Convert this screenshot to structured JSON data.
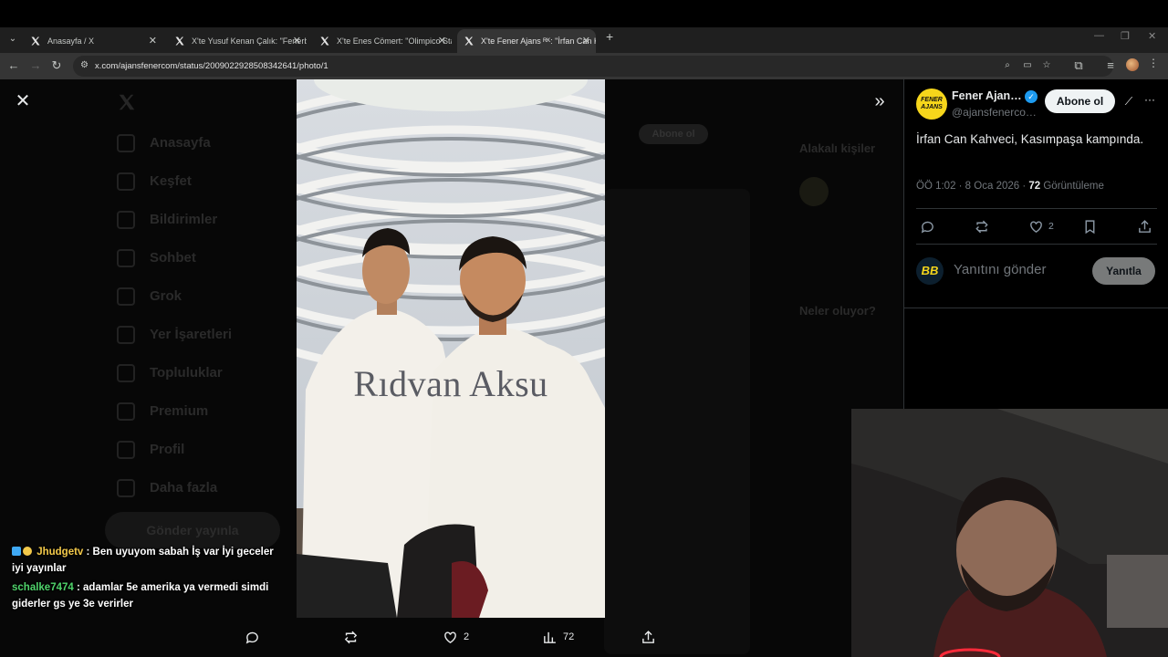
{
  "browser": {
    "tabs": [
      {
        "title": "Anasayfa / X",
        "active": false
      },
      {
        "title": "X'te Yusuf Kenan Çalık: \"Fenerb",
        "active": false
      },
      {
        "title": "X'te Enes Cömert: \"Olimpico Sta",
        "active": false
      },
      {
        "title": "X'te Fener Ajans ᴿᴷ: \"İrfan Can K",
        "active": true
      }
    ],
    "url": "x.com/ajansfenercom/status/2009022928508342641/photo/1"
  },
  "photo": {
    "watermark": "Rıdvan Aksu"
  },
  "photo_actions": {
    "likes": "2",
    "views": "72"
  },
  "chat": [
    {
      "user": "Jhudgetv",
      "text": ": Ben uyuyom sabah İş var İyi geceler iyi yayınlar"
    },
    {
      "user": "schalke7474",
      "text": ": adamlar 5e amerika ya vermedi simdi giderler gs ye 3e verirler"
    }
  ],
  "background_nav": [
    "Anasayfa",
    "Keşfet",
    "Bildirimler",
    "Sohbet",
    "Grok",
    "Yer İşaretleri",
    "Topluluklar",
    "Premium",
    "Profil",
    "Daha fazla"
  ],
  "background_post_button": "Gönder yayınla",
  "background_follow": "Abone ol",
  "background_right": {
    "related_heading": "Alakalı kişiler",
    "trending_heading": "Neler oluyor?"
  },
  "tweet": {
    "author_name": "Fener Ajan…",
    "author_handle": "@ajansfenerco…",
    "avatar_text": "FENER AJANS",
    "follow_label": "Abone ol",
    "text": "İrfan Can Kahveci, Kasımpaşa kampında.",
    "time": "ÖÖ 1:02 · 8 Oca 2026 · ",
    "views_count": "72",
    "views_label": " Görüntüleme",
    "likes": "2",
    "reply_placeholder": "Yanıtını gönder",
    "reply_button": "Yanıtla",
    "reply_avatar": "BB"
  },
  "colors": {
    "accent_blue": "#1d9bf0",
    "fener_yellow": "#f6d61b",
    "chat_user1": "#f3c94a",
    "chat_user2": "#4fd36b"
  }
}
